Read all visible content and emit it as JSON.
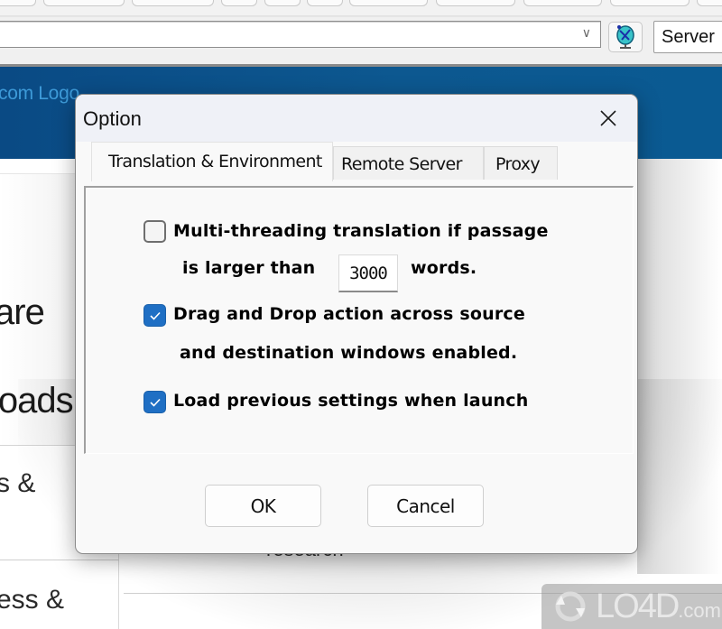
{
  "browser": {
    "address_bar_value": "",
    "server_field_value": "Server",
    "globe_button_icon": "globe-satellite-icon"
  },
  "website": {
    "logo_text": "com Logo",
    "left_nav": {
      "heading_line_1": "are",
      "heading_line_2": "loads",
      "link_1": "s &",
      "link_2": "ess &"
    },
    "hidden_text": "research"
  },
  "dialog": {
    "title": "Option",
    "close_icon": "close-icon",
    "tabs": [
      {
        "label": "Translation & Environment",
        "active": true
      },
      {
        "label": "Remote Server",
        "active": false
      },
      {
        "label": "Proxy",
        "active": false
      }
    ],
    "options": {
      "multithreading": {
        "checked": false,
        "label_line_1": "Multi-threading translation if passage",
        "label_line_2_prefix": "is larger than",
        "word_threshold": "3000",
        "label_line_2_suffix": "words."
      },
      "drag_drop": {
        "checked": true,
        "label_line_1": "Drag and Drop action across source",
        "label_line_2": "and destination windows enabled."
      },
      "load_previous": {
        "checked": true,
        "label": "Load previous settings when launch"
      }
    },
    "buttons": {
      "ok": "OK",
      "cancel": "Cancel"
    }
  },
  "watermark": {
    "brand": "LO4D",
    "suffix": ".com"
  },
  "colors": {
    "header_blue": "#0d5890",
    "checkbox_blue": "#1f6fc4",
    "logo_text": "#3d9ad8"
  }
}
